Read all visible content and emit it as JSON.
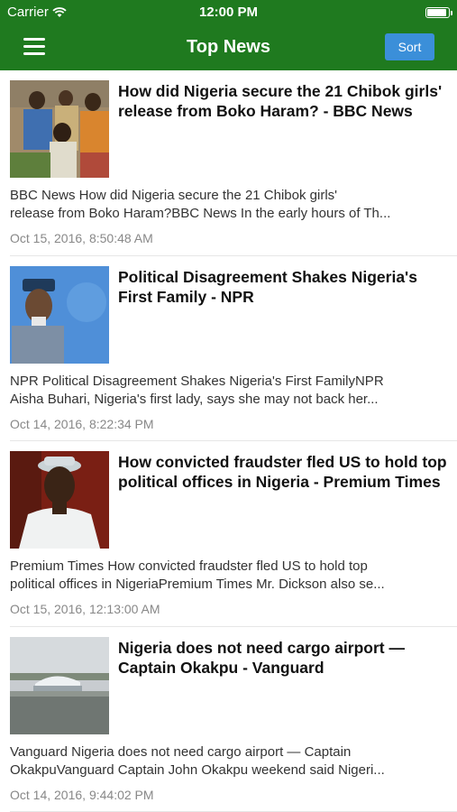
{
  "status_bar": {
    "carrier": "Carrier",
    "time": "12:00 PM",
    "battery_level": 1.0
  },
  "nav": {
    "title": "Top News",
    "sort_label": "Sort",
    "menu_icon": "hamburger-menu-icon"
  },
  "articles": [
    {
      "headline": "How did Nigeria secure the 21 Chibok girls' release from Boko Haram? - BBC News",
      "summary_line1": "BBC News    How did Nigeria secure the 21 Chibok girls'",
      "summary_line2": "release from Boko Haram?BBC News  In the early hours of Th...",
      "date": "Oct 15, 2016, 8:50:48 AM"
    },
    {
      "headline": "Political Disagreement Shakes Nigeria's First Family - NPR",
      "summary_line1": "NPR    Political Disagreement Shakes Nigeria's First FamilyNPR",
      "summary_line2": "Aisha Buhari, Nigeria's first lady, says she may not back her...",
      "date": "Oct 14, 2016, 8:22:34 PM"
    },
    {
      "headline": "How convicted fraudster fled US to hold top political offices in Nigeria - Premium Times",
      "summary_line1": "Premium Times    How convicted fraudster fled US to hold top",
      "summary_line2": "political offices in NigeriaPremium Times  Mr. Dickson also se...",
      "date": "Oct 15, 2016, 12:13:00 AM"
    },
    {
      "headline": "Nigeria does not need cargo airport — Captain Okakpu - Vanguard",
      "summary_line1": "Vanguard    Nigeria does not need cargo airport — Captain",
      "summary_line2": "OkakpuVanguard  Captain John Okakpu weekend said Nigeri...",
      "date": "Oct 14, 2016, 9:44:02 PM"
    }
  ]
}
